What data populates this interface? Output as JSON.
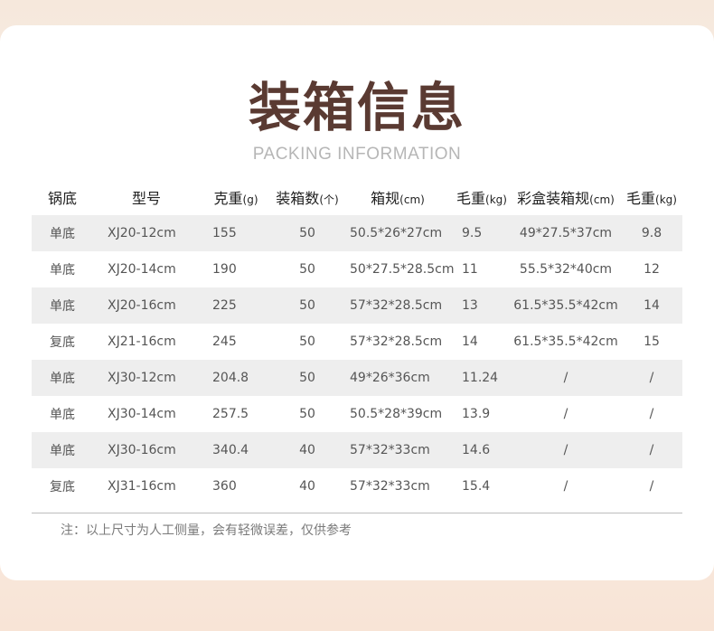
{
  "title": "装箱信息",
  "subtitle": "PACKING INFORMATION",
  "headers": [
    {
      "main": "锅底",
      "unit": ""
    },
    {
      "main": "型号",
      "unit": ""
    },
    {
      "main": "克重",
      "unit": "(g)"
    },
    {
      "main": "装箱数",
      "unit": "(个)"
    },
    {
      "main": "箱规",
      "unit": "(cm)"
    },
    {
      "main": "毛重",
      "unit": "(kg)"
    },
    {
      "main": "彩盒装箱规",
      "unit": "(cm)"
    },
    {
      "main": "毛重",
      "unit": "(kg)"
    }
  ],
  "rows": [
    [
      "单底",
      "XJ20-12cm",
      "155",
      "50",
      "50.5*26*27cm",
      "9.5",
      "49*27.5*37cm",
      "9.8"
    ],
    [
      "单底",
      "XJ20-14cm",
      "190",
      "50",
      "50*27.5*28.5cm",
      "11",
      "55.5*32*40cm",
      "12"
    ],
    [
      "单底",
      "XJ20-16cm",
      "225",
      "50",
      "57*32*28.5cm",
      "13",
      "61.5*35.5*42cm",
      "14"
    ],
    [
      "复底",
      "XJ21-16cm",
      "245",
      "50",
      "57*32*28.5cm",
      "14",
      "61.5*35.5*42cm",
      "15"
    ],
    [
      "单底",
      "XJ30-12cm",
      "204.8",
      "50",
      "49*26*36cm",
      "11.24",
      "/",
      "/"
    ],
    [
      "单底",
      "XJ30-14cm",
      "257.5",
      "50",
      "50.5*28*39cm",
      "13.9",
      "/",
      "/"
    ],
    [
      "单底",
      "XJ30-16cm",
      "340.4",
      "40",
      "57*32*33cm",
      "14.6",
      "/",
      "/"
    ],
    [
      "复底",
      "XJ31-16cm",
      "360",
      "40",
      "57*32*33cm",
      "15.4",
      "/",
      "/"
    ]
  ],
  "note": "注：以上尺寸为人工侧量，会有轻微误差，仅供参考",
  "colors": {
    "title": "#5a3a32",
    "subtitle": "#b6b6b6",
    "row_shade": "#eeeeee",
    "background": "#f6e8dc"
  }
}
